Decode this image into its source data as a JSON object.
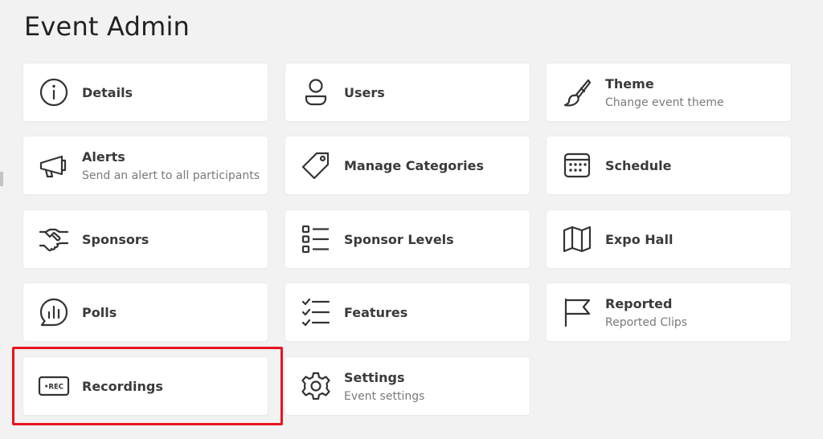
{
  "page": {
    "title": "Event Admin"
  },
  "cards": {
    "details": {
      "title": "Details",
      "icon": "info-icon"
    },
    "users": {
      "title": "Users",
      "icon": "user-icon"
    },
    "theme": {
      "title": "Theme",
      "subtitle": "Change event theme",
      "icon": "paintbrush-icon"
    },
    "alerts": {
      "title": "Alerts",
      "subtitle": "Send an alert to all participants",
      "icon": "megaphone-icon"
    },
    "manage_categories": {
      "title": "Manage Categories",
      "icon": "tag-icon"
    },
    "schedule": {
      "title": "Schedule",
      "icon": "calendar-icon"
    },
    "sponsors": {
      "title": "Sponsors",
      "icon": "handshake-icon"
    },
    "sponsor_levels": {
      "title": "Sponsor Levels",
      "icon": "list-icon"
    },
    "expo_hall": {
      "title": "Expo Hall",
      "icon": "map-icon"
    },
    "polls": {
      "title": "Polls",
      "icon": "poll-chat-icon"
    },
    "features": {
      "title": "Features",
      "icon": "checklist-icon"
    },
    "reported": {
      "title": "Reported",
      "subtitle": "Reported Clips",
      "icon": "flag-icon"
    },
    "recordings": {
      "title": "Recordings",
      "icon": "rec-icon",
      "icon_text": "•REC"
    },
    "settings": {
      "title": "Settings",
      "subtitle": "Event settings",
      "icon": "gear-icon"
    }
  },
  "colors": {
    "highlight": "#e8141c",
    "background": "#f2f2f3",
    "card": "#ffffff",
    "icon": "#333333"
  }
}
